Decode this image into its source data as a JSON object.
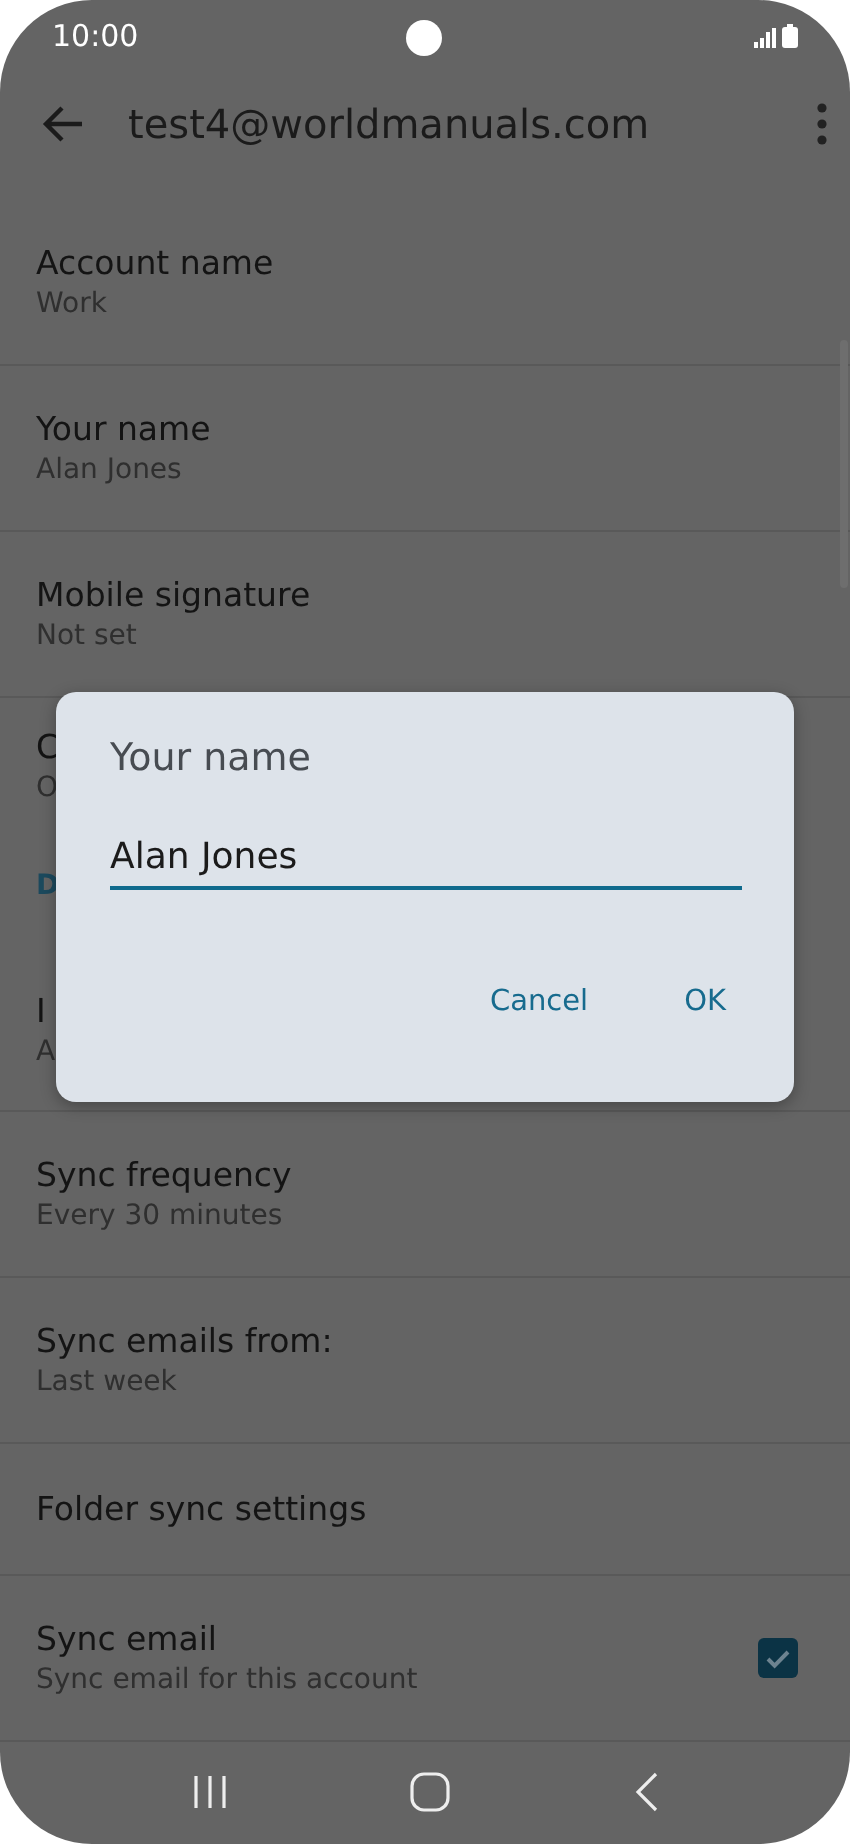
{
  "status_bar": {
    "time": "10:00"
  },
  "app_bar": {
    "title": "test4@worldmanuals.com"
  },
  "settings": [
    {
      "kind": "setting",
      "title": "Account name",
      "subtitle": "Work"
    },
    {
      "kind": "setting",
      "title": "Your name",
      "subtitle": "Alan Jones"
    },
    {
      "kind": "setting",
      "title": "Mobile signature",
      "subtitle": "Not set"
    },
    {
      "kind": "setting",
      "title": "C",
      "subtitle": "O"
    },
    {
      "kind": "header",
      "title": "D"
    },
    {
      "kind": "setting",
      "title": "I",
      "subtitle": "A"
    },
    {
      "kind": "setting",
      "title": "Sync frequency",
      "subtitle": "Every 30 minutes"
    },
    {
      "kind": "setting",
      "title": "Sync emails from:",
      "subtitle": "Last week"
    },
    {
      "kind": "setting",
      "title": "Folder sync settings"
    },
    {
      "kind": "checkbox",
      "title": "Sync email",
      "subtitle": "Sync email for this account",
      "checked": true
    }
  ],
  "dialog": {
    "title": "Your name",
    "value": "Alan Jones",
    "buttons": [
      "Cancel",
      "OK"
    ]
  }
}
